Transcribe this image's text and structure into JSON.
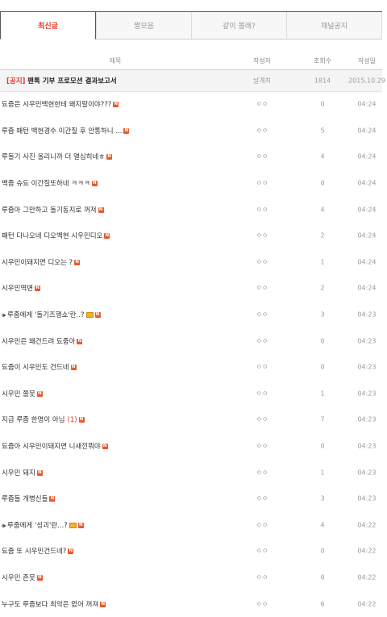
{
  "tabs": [
    "최신글",
    "짤모음",
    "같이 볼래?",
    "채널공지"
  ],
  "active_tab": 0,
  "columns": {
    "title": "제목",
    "author": "작성자",
    "views": "조회수",
    "date": "작성일"
  },
  "notice": {
    "tag": "[공지]",
    "title": "팬톡 기부 프로모션 결과보고서",
    "author": "날개치",
    "views": "1814",
    "date": "2015.10.29"
  },
  "posts": [
    {
      "title": "됴줍은 시우민백현한테 왜지랄이야???",
      "author": "ㅇㅇ",
      "views": "0",
      "date": "04:24",
      "new": true
    },
    {
      "title": "루줍 패턴 백현경수 이간질 후 안통하니 ...",
      "author": "ㅇㅇ",
      "views": "5",
      "date": "04:24",
      "new": true
    },
    {
      "title": "루돌기 사진 올리니까 더 열심히네ㅎ",
      "author": "ㅇㅇ",
      "views": "4",
      "date": "04:24",
      "new": true
    },
    {
      "title": "백줍 슈됴 이간질또하네 ㅋㅋㅋ",
      "author": "ㅇㅇ",
      "views": "0",
      "date": "04:24",
      "new": true
    },
    {
      "title": "루줍아 그만하고 돌기동지로 꺼져",
      "author": "ㅇㅇ",
      "views": "4",
      "date": "04:24",
      "new": true
    },
    {
      "title": "패턴 다나오네 디오백현 시우민디오",
      "author": "ㅇㅇ",
      "views": "2",
      "date": "04:24",
      "new": true
    },
    {
      "title": "시우민이돼지면 디오는 ?",
      "author": "ㅇㅇ",
      "views": "1",
      "date": "04:24",
      "new": true
    },
    {
      "title": "시우민역변",
      "author": "ㅇㅇ",
      "views": "2",
      "date": "04:24",
      "new": true
    },
    {
      "title": "루줍에게 '돌기즈행쇼'란..?",
      "author": "ㅇㅇ",
      "views": "3",
      "date": "04:23",
      "new": true,
      "speaker": true,
      "image": true
    },
    {
      "title": "시우민은 왜건드려 됴줍아",
      "author": "ㅇㅇ",
      "views": "0",
      "date": "04:23",
      "new": true
    },
    {
      "title": "됴줍이 시우민도 건드네",
      "author": "ㅇㅇ",
      "views": "0",
      "date": "04:23",
      "new": true
    },
    {
      "title": "시우민 쫄못",
      "author": "ㅇㅇ",
      "views": "1",
      "date": "04:23",
      "new": true
    },
    {
      "title": "지금 루줍 한명이 아님",
      "comments": "(1)",
      "author": "ㅇㅇ",
      "views": "7",
      "date": "04:23",
      "new": true
    },
    {
      "title": "됴줍아 시우민이돼지면 니새낀뭐야",
      "author": "ㅇㅇ",
      "views": "0",
      "date": "04:23",
      "new": true
    },
    {
      "title": "시우민 돼지",
      "author": "ㅇㅇ",
      "views": "1",
      "date": "04:23",
      "new": true
    },
    {
      "title": "루줍들 개병신들",
      "author": "ㅇㅇ",
      "views": "3",
      "date": "04:23",
      "new": true
    },
    {
      "title": "루줍에게 '성괴'란...?",
      "author": "ㅇㅇ",
      "views": "4",
      "date": "04:22",
      "new": true,
      "speaker": true,
      "image": true
    },
    {
      "title": "됴줍 또 시우민건드네?",
      "author": "ㅇㅇ",
      "views": "0",
      "date": "04:22",
      "new": true
    },
    {
      "title": "시우민 존못",
      "author": "ㅇㅇ",
      "views": "0",
      "date": "04:22",
      "new": true
    },
    {
      "title": "누구도 루줍보다 최악은 없어 꺼져",
      "author": "ㅇㅇ",
      "views": "6",
      "date": "04:22",
      "new": true
    }
  ],
  "colors": {
    "accent": "#e2392b",
    "new_badge": "#e85a2a"
  }
}
